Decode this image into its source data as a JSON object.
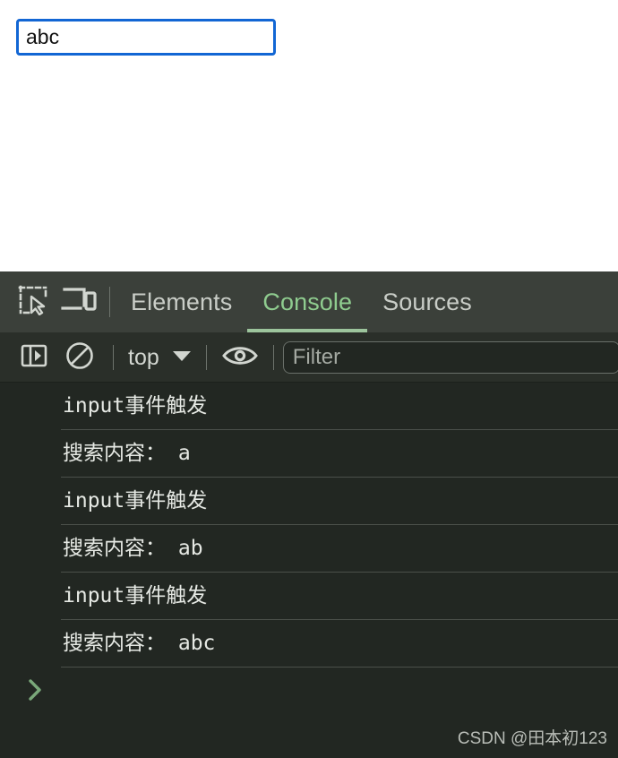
{
  "page": {
    "search_field": {
      "value": "abc",
      "placeholder": ""
    }
  },
  "devtools": {
    "tabbar": {
      "inspect_icon": "inspect-element-icon",
      "device_icon": "device-toolbar-icon",
      "tabs": [
        {
          "label": "Elements",
          "active": false
        },
        {
          "label": "Console",
          "active": true
        },
        {
          "label": "Sources",
          "active": false
        }
      ]
    },
    "filterbar": {
      "sidebar_icon": "show-console-sidebar-icon",
      "clear_icon": "clear-console-icon",
      "context_label": "top",
      "context_dropdown_icon": "chevron-down-icon",
      "eye_icon": "live-expression-eye-icon",
      "filter": {
        "value": "",
        "placeholder": "Filter"
      }
    },
    "console": {
      "messages": [
        {
          "text": "input事件触发"
        },
        {
          "text": "搜索内容： a"
        },
        {
          "text": "input事件触发"
        },
        {
          "text": "搜索内容： ab"
        },
        {
          "text": "input事件触发"
        },
        {
          "text": "搜索内容： abc"
        }
      ],
      "prompt_icon": "prompt-chevron-icon"
    },
    "watermark": "CSDN @田本初123"
  },
  "colors": {
    "input_focus_border": "#1266d4",
    "tabbar_bg": "#3b403a",
    "filterbar_bg": "#2a2f29",
    "console_bg": "#222722",
    "active_tab_text": "#8fcc8f",
    "active_tab_underline": "#9cc49c",
    "prompt_green": "#7aa87a",
    "console_text": "#e6e9e4"
  }
}
